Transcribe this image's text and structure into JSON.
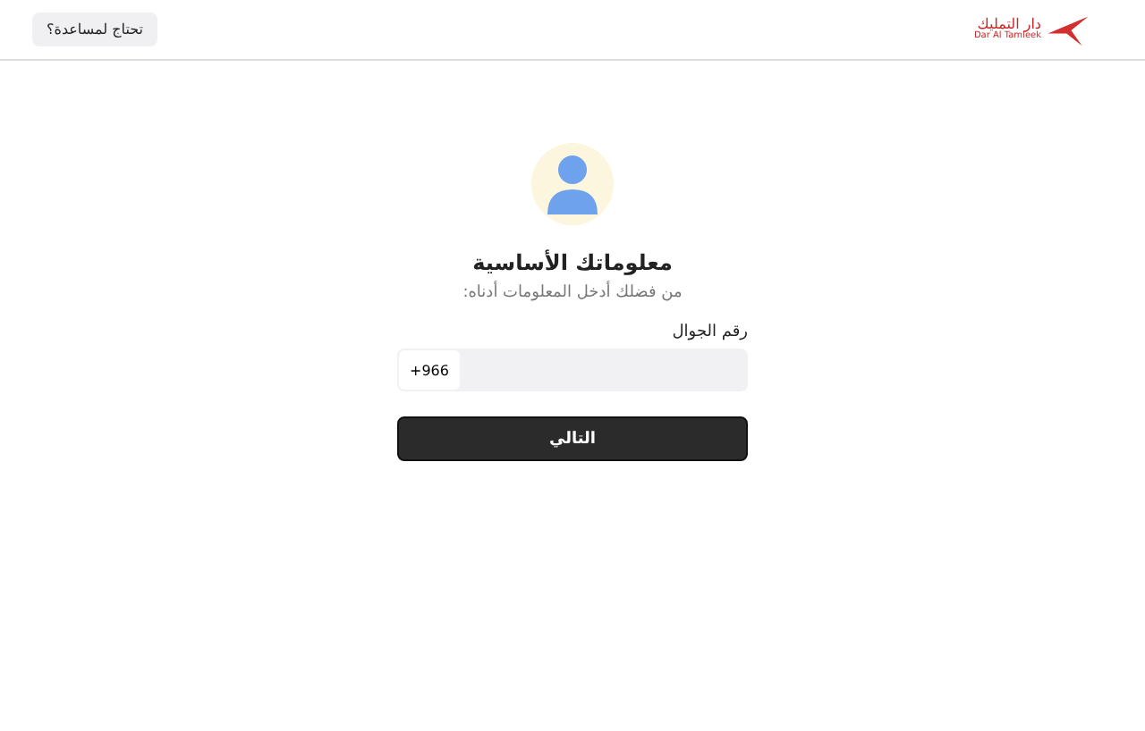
{
  "header": {
    "logo": {
      "arabic": "دار التمليك",
      "latin": "Dar Al Tamleek"
    },
    "help_button": "تحتاج لمساعدة؟"
  },
  "form": {
    "title": "معلوماتك الأساسية",
    "subtitle": "من فضلك أدخل المعلومات أدناه:",
    "phone_label": "رقم الجوال",
    "country_code": "+966",
    "submit": "التالي"
  }
}
